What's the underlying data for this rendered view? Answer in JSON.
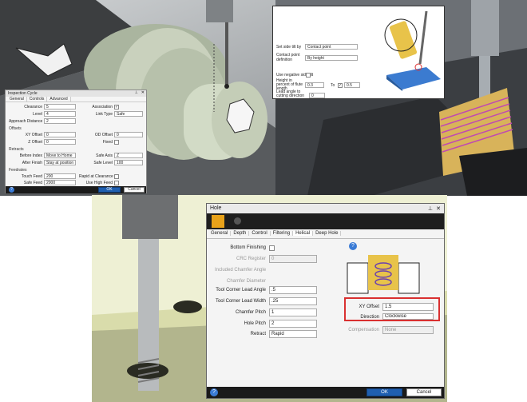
{
  "inspection": {
    "title": "Inspection Cycle",
    "tabs": [
      "General",
      "Controls",
      "Advanced"
    ],
    "fields": [
      {
        "label": "Clearance",
        "value": "5"
      },
      {
        "label": "Level",
        "value": "4"
      },
      {
        "label": "Approach Distance",
        "value": "2"
      }
    ],
    "association_label": "Association",
    "link_type_label": "Link Type",
    "link_type_value": "Safe",
    "offsets_header": "Offsets",
    "xy_offset_label": "XY Offset",
    "xy_offset_value": "0",
    "z_offset_label": "Z Offset",
    "z_offset_value": "0",
    "od_offset_label": "OD Offset",
    "od_offset_value": "0",
    "fixed_label": "Fixed",
    "retracts_header": "Retracts",
    "before_label": "Before Index",
    "before_value": "Move to Home",
    "after_label": "After Finish",
    "after_value": "Stay at position",
    "safe_axis_label": "Safe Axis",
    "safe_axis_value": "Z",
    "safe_level_label": "Safe Level",
    "safe_level_value": "100",
    "feedrates_header": "Feedrates",
    "touch_feed_label": "Touch Feed",
    "touch_feed_value": "200",
    "safe_feed_label": "Safe Feed",
    "safe_feed_value": "2000",
    "rapid_label": "Rapid at Clearance",
    "high_feed_label": "Use High Feed",
    "ok": "OK",
    "cancel": "Cancel"
  },
  "contact": {
    "side_label": "Set side tilt by",
    "side_value": "Contact point",
    "def_label": "Contact point definition",
    "def_value": "By height",
    "neg_label": "Use negative side tilt",
    "height_label": "Height in percent of flute length",
    "height_value": "0.3",
    "to_label": "To",
    "to_value": "0.5",
    "lead_label": "Lead angle to cutting direction",
    "lead_value": "0"
  },
  "hole": {
    "title": "Hole",
    "tabs": [
      "General",
      "Depth",
      "Control",
      "Filtering",
      "Helical",
      "Deep Hole"
    ],
    "active_tab": "Helical",
    "bottom_finishing": "Bottom Finishing",
    "crc_label": "CRC Register",
    "crc_value": "0",
    "inc_label": "Included Chamfer Angle",
    "cd_label": "Chamfer Diameter",
    "tcla_label": "Tool Corner Lead Angle",
    "tcla_value": ".5",
    "tclw_label": "Tool Corner Lead Width",
    "tclw_value": ".25",
    "cp_label": "Chamfer Pitch",
    "cp_value": "1",
    "hp_label": "Hole Pitch",
    "hp_value": "2",
    "retract_label": "Retract",
    "retract_value": "Rapid",
    "xy_label": "XY Offset",
    "xy_value": "1.5",
    "dir_label": "Direction",
    "dir_value": "Clockwise",
    "comp_label": "Compensation",
    "comp_value": "None",
    "ok": "OK",
    "cancel": "Cancel"
  },
  "colors": {
    "accent": "#1f5fb0",
    "highlight": "#d93030",
    "coil": "#c04ab0"
  }
}
